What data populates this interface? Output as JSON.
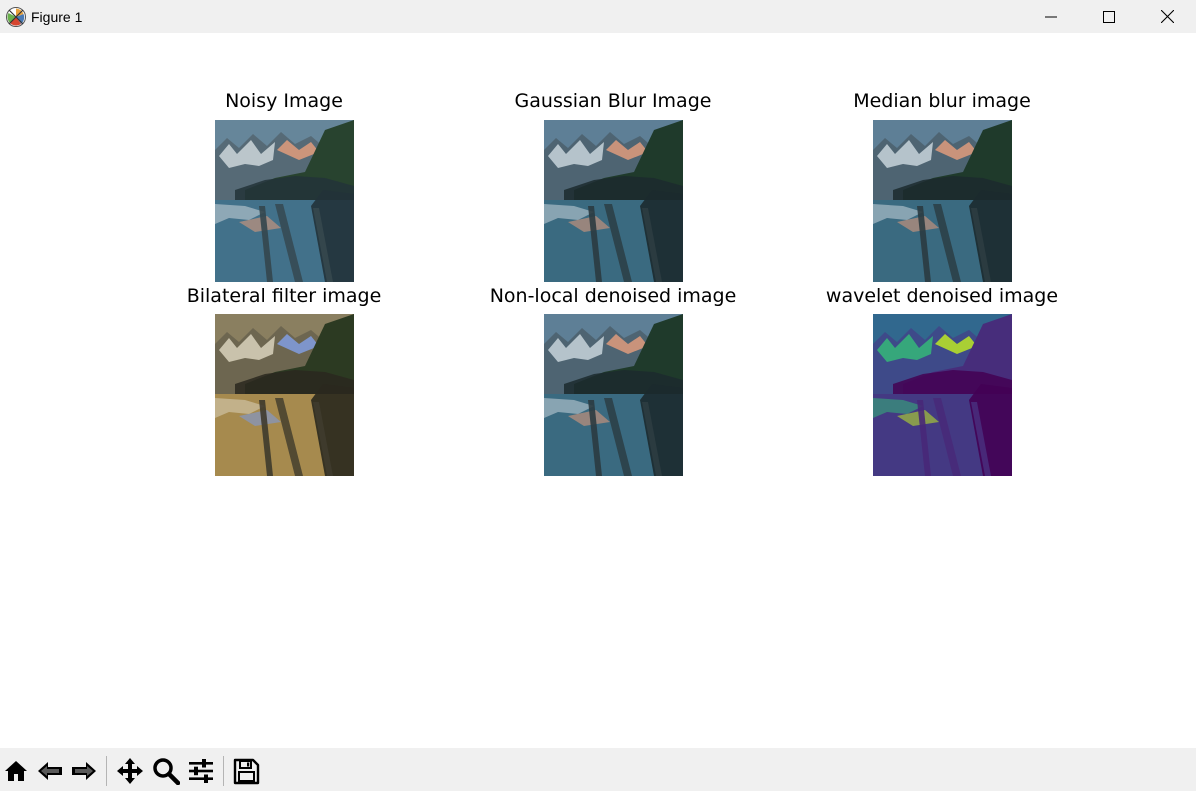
{
  "window": {
    "title": "Figure 1",
    "icons": [
      "matplotlib-app-icon",
      "minimize-icon",
      "maximize-icon",
      "close-icon"
    ]
  },
  "figure": {
    "subplots": [
      {
        "title": "Noisy Image",
        "palette": "noisy"
      },
      {
        "title": "Gaussian Blur Image",
        "palette": "normal"
      },
      {
        "title": "Median blur image",
        "palette": "normal"
      },
      {
        "title": "Bilateral filter image",
        "palette": "bilateral"
      },
      {
        "title": "Non-local denoised image",
        "palette": "normal"
      },
      {
        "title": "wavelet denoised image",
        "palette": "viridis"
      }
    ]
  },
  "toolbar": {
    "tools": [
      "home-icon",
      "back-icon",
      "forward-icon",
      "pan-icon",
      "zoom-icon",
      "configure-subplots-icon",
      "save-icon"
    ]
  },
  "palettes": {
    "normal": {
      "sky": "#5e7f96",
      "snow": "#c8d4da",
      "rock": "#4e6472",
      "peak": "#d7987c",
      "forest": "#1f3a2b",
      "water": "#3a6a80",
      "log": "#2b3b40",
      "dark": "#1c2a2e"
    },
    "noisy": {
      "sky": "#66869a",
      "snow": "#cdd6da",
      "rock": "#566a76",
      "peak": "#d99a7c",
      "forest": "#28432f",
      "water": "#42718a",
      "log": "#34464c",
      "dark": "#223238"
    },
    "bilateral": {
      "sky": "#8a7f60",
      "snow": "#d9d2bc",
      "rock": "#6d6650",
      "peak": "#7f9ad8",
      "forest": "#2c3a22",
      "water": "#a68a4e",
      "log": "#3e3a2c",
      "dark": "#2a281e"
    },
    "viridis": {
      "sky": "#31688e",
      "snow": "#35b779",
      "rock": "#3e4a89",
      "peak": "#b5de2b",
      "forest": "#472d7b",
      "water": "#443983",
      "log": "#482878",
      "dark": "#440154"
    }
  }
}
